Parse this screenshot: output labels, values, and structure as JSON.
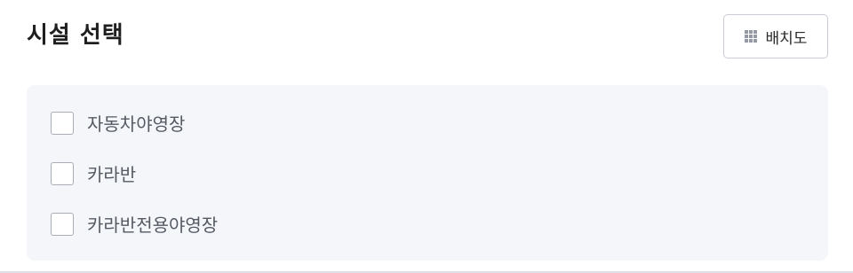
{
  "header": {
    "title": "시설 선택",
    "layout_button": {
      "label": "배치도",
      "icon": "grid-icon"
    }
  },
  "facilities": [
    {
      "label": "자동차야영장",
      "checked": false
    },
    {
      "label": "카라반",
      "checked": false
    },
    {
      "label": "카라반전용야영장",
      "checked": false
    }
  ],
  "colors": {
    "panel_background": "#f4f6fa",
    "checkbox_border": "#a9adb5",
    "label_text": "#555a62",
    "title_text": "#1f1f1f"
  }
}
